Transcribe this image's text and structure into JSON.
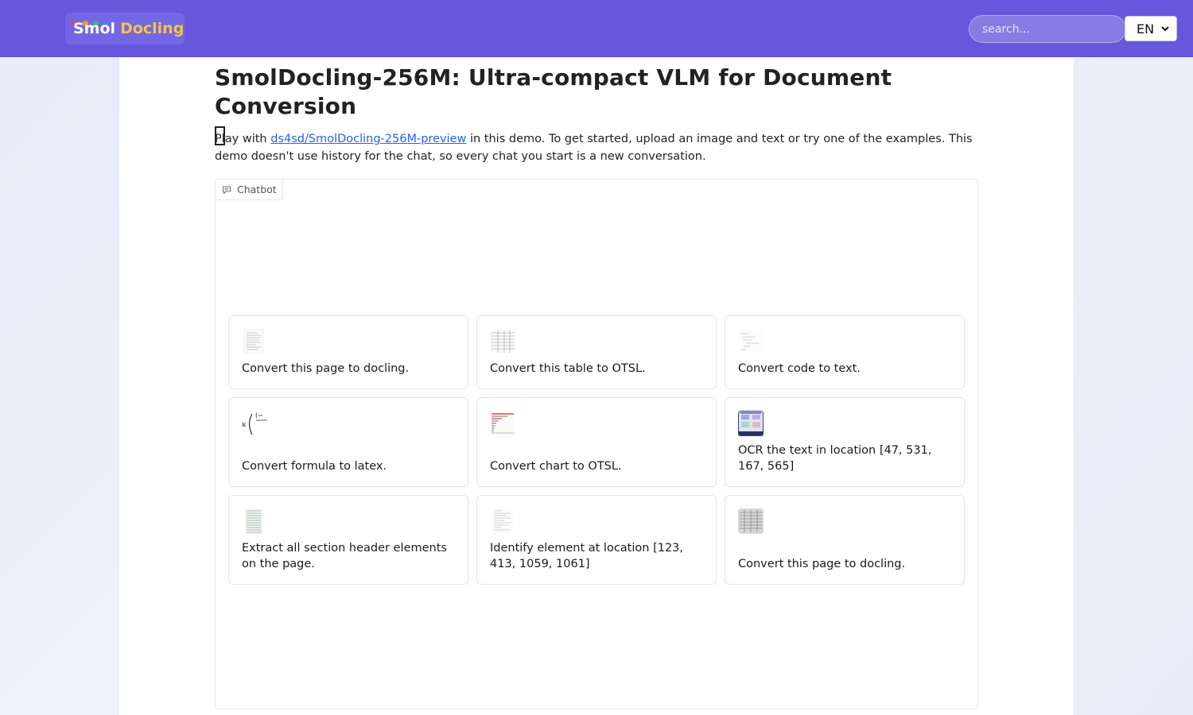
{
  "header": {
    "logo_smol": "Smol",
    "logo_docling": "Docling",
    "search_placeholder": "search...",
    "language": "EN",
    "colors": {
      "bar": "#6657dd",
      "accent": "#f5c542"
    }
  },
  "main": {
    "title": "SmolDocling-256M: Ultra-compact VLM for Document Conversion",
    "description_before": "Play with ",
    "description_link": "ds4sd/SmolDocling-256M-preview",
    "description_after": " in this demo. To get started, upload an image and text or try one of the examples. This demo doesn't use history for the chat, so every chat you start is a new conversation.",
    "chatbot_label": "Chatbot"
  },
  "examples": [
    {
      "text": "Convert this page to docling.",
      "icon": "document-page-thumbnail"
    },
    {
      "text": "Convert this table to OTSL.",
      "icon": "table-thumbnail"
    },
    {
      "text": "Convert code to text.",
      "icon": "code-thumbnail"
    },
    {
      "text": "Convert formula to latex.",
      "icon": "formula-thumbnail"
    },
    {
      "text": "Convert chart to OTSL.",
      "icon": "chart-thumbnail"
    },
    {
      "text": "OCR the text in location [47, 531, 167, 565]",
      "icon": "screenshot-thumbnail"
    },
    {
      "text": "Extract all section header elements on the page.",
      "icon": "page-headers-thumbnail"
    },
    {
      "text": "Identify element at location [123, 413, 1059, 1061]",
      "icon": "page-layout-thumbnail"
    },
    {
      "text": "Convert this page to docling.",
      "icon": "scanned-page-thumbnail"
    }
  ]
}
